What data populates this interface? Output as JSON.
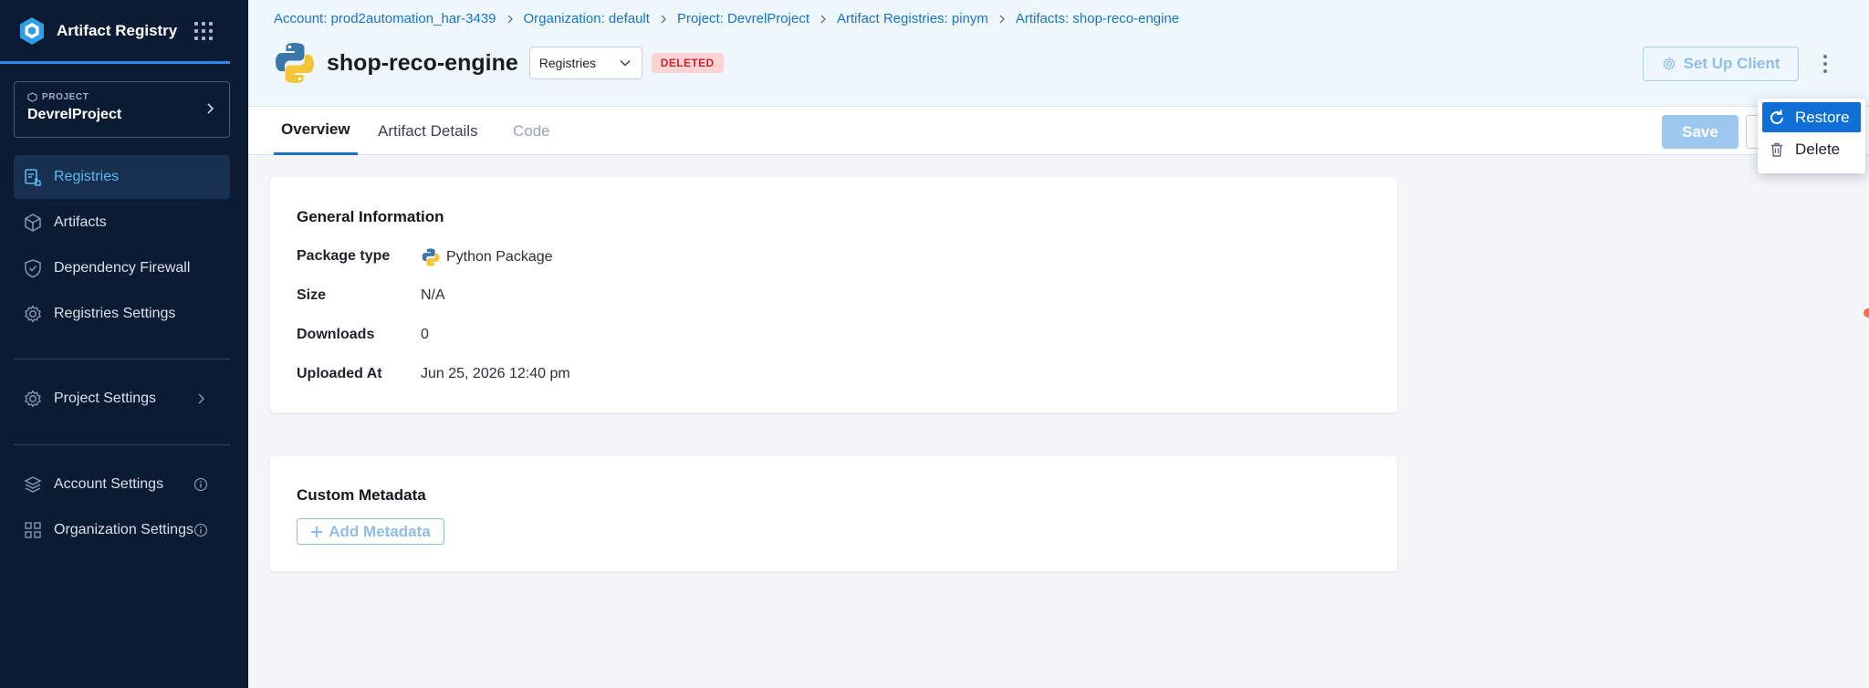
{
  "app": {
    "name": "Artifact Registry"
  },
  "project_selector": {
    "kicker": "PROJECT",
    "name": "DevrelProject"
  },
  "sidebar": {
    "items": [
      {
        "label": "Registries",
        "icon": "registries-icon",
        "active": true
      },
      {
        "label": "Artifacts",
        "icon": "cube-icon"
      },
      {
        "label": "Dependency Firewall",
        "icon": "shield-icon"
      },
      {
        "label": "Registries Settings",
        "icon": "gear-icon"
      }
    ],
    "project_settings": {
      "label": "Project Settings",
      "icon": "gear-icon"
    },
    "account_settings": {
      "label": "Account Settings",
      "icon": "layers-icon"
    },
    "organization_settings": {
      "label": "Organization Settings",
      "icon": "org-icon"
    }
  },
  "breadcrumbs": [
    "Account: prod2automation_har-3439",
    "Organization: default",
    "Project: DevrelProject",
    "Artifact Registries: pinym",
    "Artifacts: shop-reco-engine"
  ],
  "artifact": {
    "title": "shop-reco-engine",
    "registry_select": "Registries",
    "status_badge": "DELETED"
  },
  "header_actions": {
    "setup_client": "Set Up Client"
  },
  "tabs": [
    {
      "label": "Overview",
      "state": "active"
    },
    {
      "label": "Artifact Details",
      "state": "normal"
    },
    {
      "label": "Code",
      "state": "disabled"
    }
  ],
  "toolbar": {
    "save_label": "Save"
  },
  "general_info": {
    "title": "General Information",
    "rows": [
      {
        "label": "Package type",
        "value": "Python Package"
      },
      {
        "label": "Size",
        "value": "N/A"
      },
      {
        "label": "Downloads",
        "value": "0"
      },
      {
        "label": "Uploaded At",
        "value": "Jun 25, 2026 12:40 pm"
      }
    ]
  },
  "custom_metadata": {
    "title": "Custom Metadata",
    "add_label": "Add Metadata"
  },
  "menu": {
    "items": [
      {
        "label": "Restore",
        "icon": "restore-icon"
      },
      {
        "label": "Delete",
        "icon": "trash-icon"
      }
    ]
  },
  "colors": {
    "sidebar_bg": "#0b1b33",
    "accent": "#1a73c9",
    "active_nav_text": "#5fb7f5",
    "deleted_badge_bg": "#fcd4d6",
    "deleted_badge_text": "#c4282f",
    "menu_highlight": "#0f6fd4"
  }
}
